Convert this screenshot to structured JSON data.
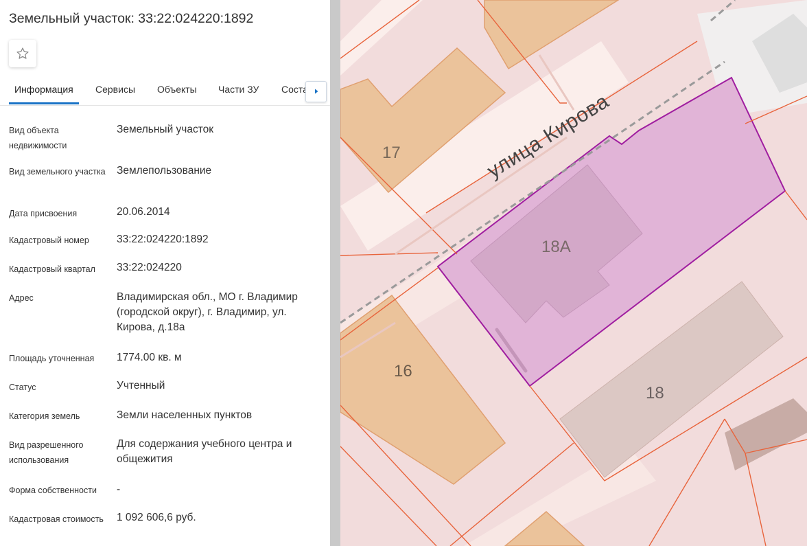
{
  "panel": {
    "title": "Земельный участок: 33:22:024220:1892",
    "favorite_icon": "star-outline-icon",
    "tabs": [
      {
        "label": "Информация",
        "active": true
      },
      {
        "label": "Сервисы",
        "active": false
      },
      {
        "label": "Объекты",
        "active": false
      },
      {
        "label": "Части ЗУ",
        "active": false
      },
      {
        "label": "Соста",
        "active": false
      }
    ],
    "tab_scroll_icon": "chevron-right-icon",
    "rows": [
      {
        "label": "Вид объекта недвижимости",
        "value": "Земельный участок"
      },
      {
        "label": "Вид земельного участка",
        "value": "Землепользование"
      },
      {
        "label": "Дата присвоения",
        "value": "20.06.2014"
      },
      {
        "label": "Кадастровый номер",
        "value": "33:22:024220:1892"
      },
      {
        "label": "Кадастровый квартал",
        "value": "33:22:024220"
      },
      {
        "label": "Адрес",
        "value": "Владимирская обл., МО г. Владимир (городской округ), г. Владимир, ул. Кирова, д.18а"
      },
      {
        "label": "Площадь уточненная",
        "value": "1774.00 кв. м"
      },
      {
        "label": "Статус",
        "value": "Учтенный"
      },
      {
        "label": "Категория земель",
        "value": "Земли населенных пунктов"
      },
      {
        "label": "Вид разрешенного использования",
        "value": "Для содержания учебного центра и общежития"
      },
      {
        "label": "Форма собственности",
        "value": "-"
      },
      {
        "label": "Кадастровая стоимость",
        "value": "1 092 606,6 руб."
      }
    ]
  },
  "map": {
    "street_label": "улица Кирова",
    "building_labels": {
      "b17": "17",
      "b18a": "18А",
      "b16": "16",
      "b18": "18"
    },
    "colors": {
      "background": "#f2dcdc",
      "road": "#fbeeeb",
      "parcel_border": "#e8643c",
      "building_orange": "#ebc39b",
      "building_gray": "#dcc8c4",
      "selected_fill": "#e1b4d7",
      "selected_border": "#a01ea0"
    }
  }
}
